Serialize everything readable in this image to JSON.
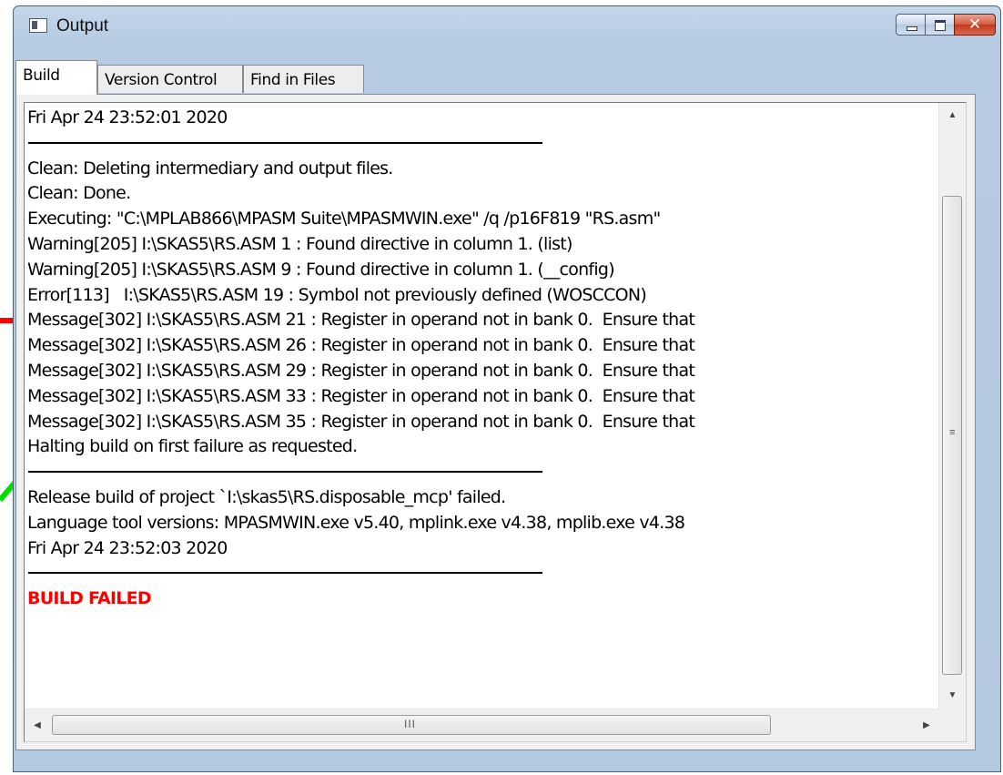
{
  "window": {
    "title": "Output",
    "close_glyph": "✕"
  },
  "tabs": [
    {
      "label": "Build",
      "active": true
    },
    {
      "label": "Version Control",
      "active": false
    },
    {
      "label": "Find in Files",
      "active": false
    }
  ],
  "output": {
    "lines": [
      {
        "type": "text",
        "text": "Fri Apr 24 23:52:01 2020"
      },
      {
        "type": "separator",
        "text": ""
      },
      {
        "type": "text",
        "text": "Clean: Deleting intermediary and output files."
      },
      {
        "type": "text",
        "text": "Clean: Done."
      },
      {
        "type": "text",
        "text": "Executing: \"C:\\MPLAB866\\MPASM Suite\\MPASMWIN.exe\" /q /p16F819 \"RS.asm\""
      },
      {
        "type": "text",
        "text": "Warning[205] I:\\SKAS5\\RS.ASM 1 : Found directive in column 1. (list)"
      },
      {
        "type": "text",
        "text": "Warning[205] I:\\SKAS5\\RS.ASM 9 : Found directive in column 1. (__config)"
      },
      {
        "type": "text",
        "text": "Error[113]   I:\\SKAS5\\RS.ASM 19 : Symbol not previously defined (WOSCCON)"
      },
      {
        "type": "text",
        "text": "Message[302] I:\\SKAS5\\RS.ASM 21 : Register in operand not in bank 0.  Ensure that"
      },
      {
        "type": "text",
        "text": "Message[302] I:\\SKAS5\\RS.ASM 26 : Register in operand not in bank 0.  Ensure that"
      },
      {
        "type": "text",
        "text": "Message[302] I:\\SKAS5\\RS.ASM 29 : Register in operand not in bank 0.  Ensure that"
      },
      {
        "type": "text",
        "text": "Message[302] I:\\SKAS5\\RS.ASM 33 : Register in operand not in bank 0.  Ensure that"
      },
      {
        "type": "text",
        "text": "Message[302] I:\\SKAS5\\RS.ASM 35 : Register in operand not in bank 0.  Ensure that"
      },
      {
        "type": "text",
        "text": "Halting build on first failure as requested."
      },
      {
        "type": "separator",
        "text": ""
      },
      {
        "type": "text",
        "text": "Release build of project `I:\\skas5\\RS.disposable_mcp' failed."
      },
      {
        "type": "text",
        "text": "Language tool versions: MPASMWIN.exe v5.40, mplink.exe v4.38, mplib.exe v4.38"
      },
      {
        "type": "text",
        "text": "Fri Apr 24 23:52:03 2020"
      },
      {
        "type": "separator",
        "text": ""
      },
      {
        "type": "failed",
        "text": "BUILD FAILED"
      }
    ]
  },
  "scrollbars": {
    "vertical_grip": "≡",
    "horizontal_grip": "III",
    "up_arrow": "▲",
    "down_arrow": "▼",
    "left_arrow": "◀",
    "right_arrow": "▶"
  },
  "annotations": {
    "error_arrow_color": "#ff0000",
    "message_arrow_color": "#00dd00"
  }
}
